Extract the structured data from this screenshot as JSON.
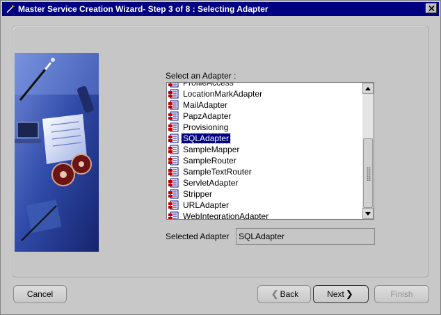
{
  "window": {
    "title": "Master Service Creation Wizard- Step 3 of 8 : Selecting Adapter"
  },
  "adapter_list": {
    "label": "Select an Adapter :",
    "items": [
      {
        "label": "ProfileAccess"
      },
      {
        "label": "LocationMarkAdapter"
      },
      {
        "label": "MailAdapter"
      },
      {
        "label": "PapzAdapter"
      },
      {
        "label": "Provisioning"
      },
      {
        "label": "SQLAdapter"
      },
      {
        "label": "SampleMapper"
      },
      {
        "label": "SampleRouter"
      },
      {
        "label": "SampleTextRouter"
      },
      {
        "label": "ServletAdapter"
      },
      {
        "label": "Stripper"
      },
      {
        "label": "URLAdapter"
      },
      {
        "label": "WebIntegrationAdapter"
      }
    ],
    "selected_index": 5
  },
  "selected_adapter": {
    "label": "Selected Adapter",
    "value": "SQLAdapter"
  },
  "buttons": {
    "cancel": "Cancel",
    "back": "Back",
    "next": "Next",
    "finish": "Finish"
  },
  "icons": {
    "title": "wizard-wand-icon",
    "close": "close-icon",
    "item": "adapter-file-icon"
  },
  "colors": {
    "titlebar": "#000080",
    "selection": "#000080",
    "dialog_bg": "#c6c6c6"
  }
}
